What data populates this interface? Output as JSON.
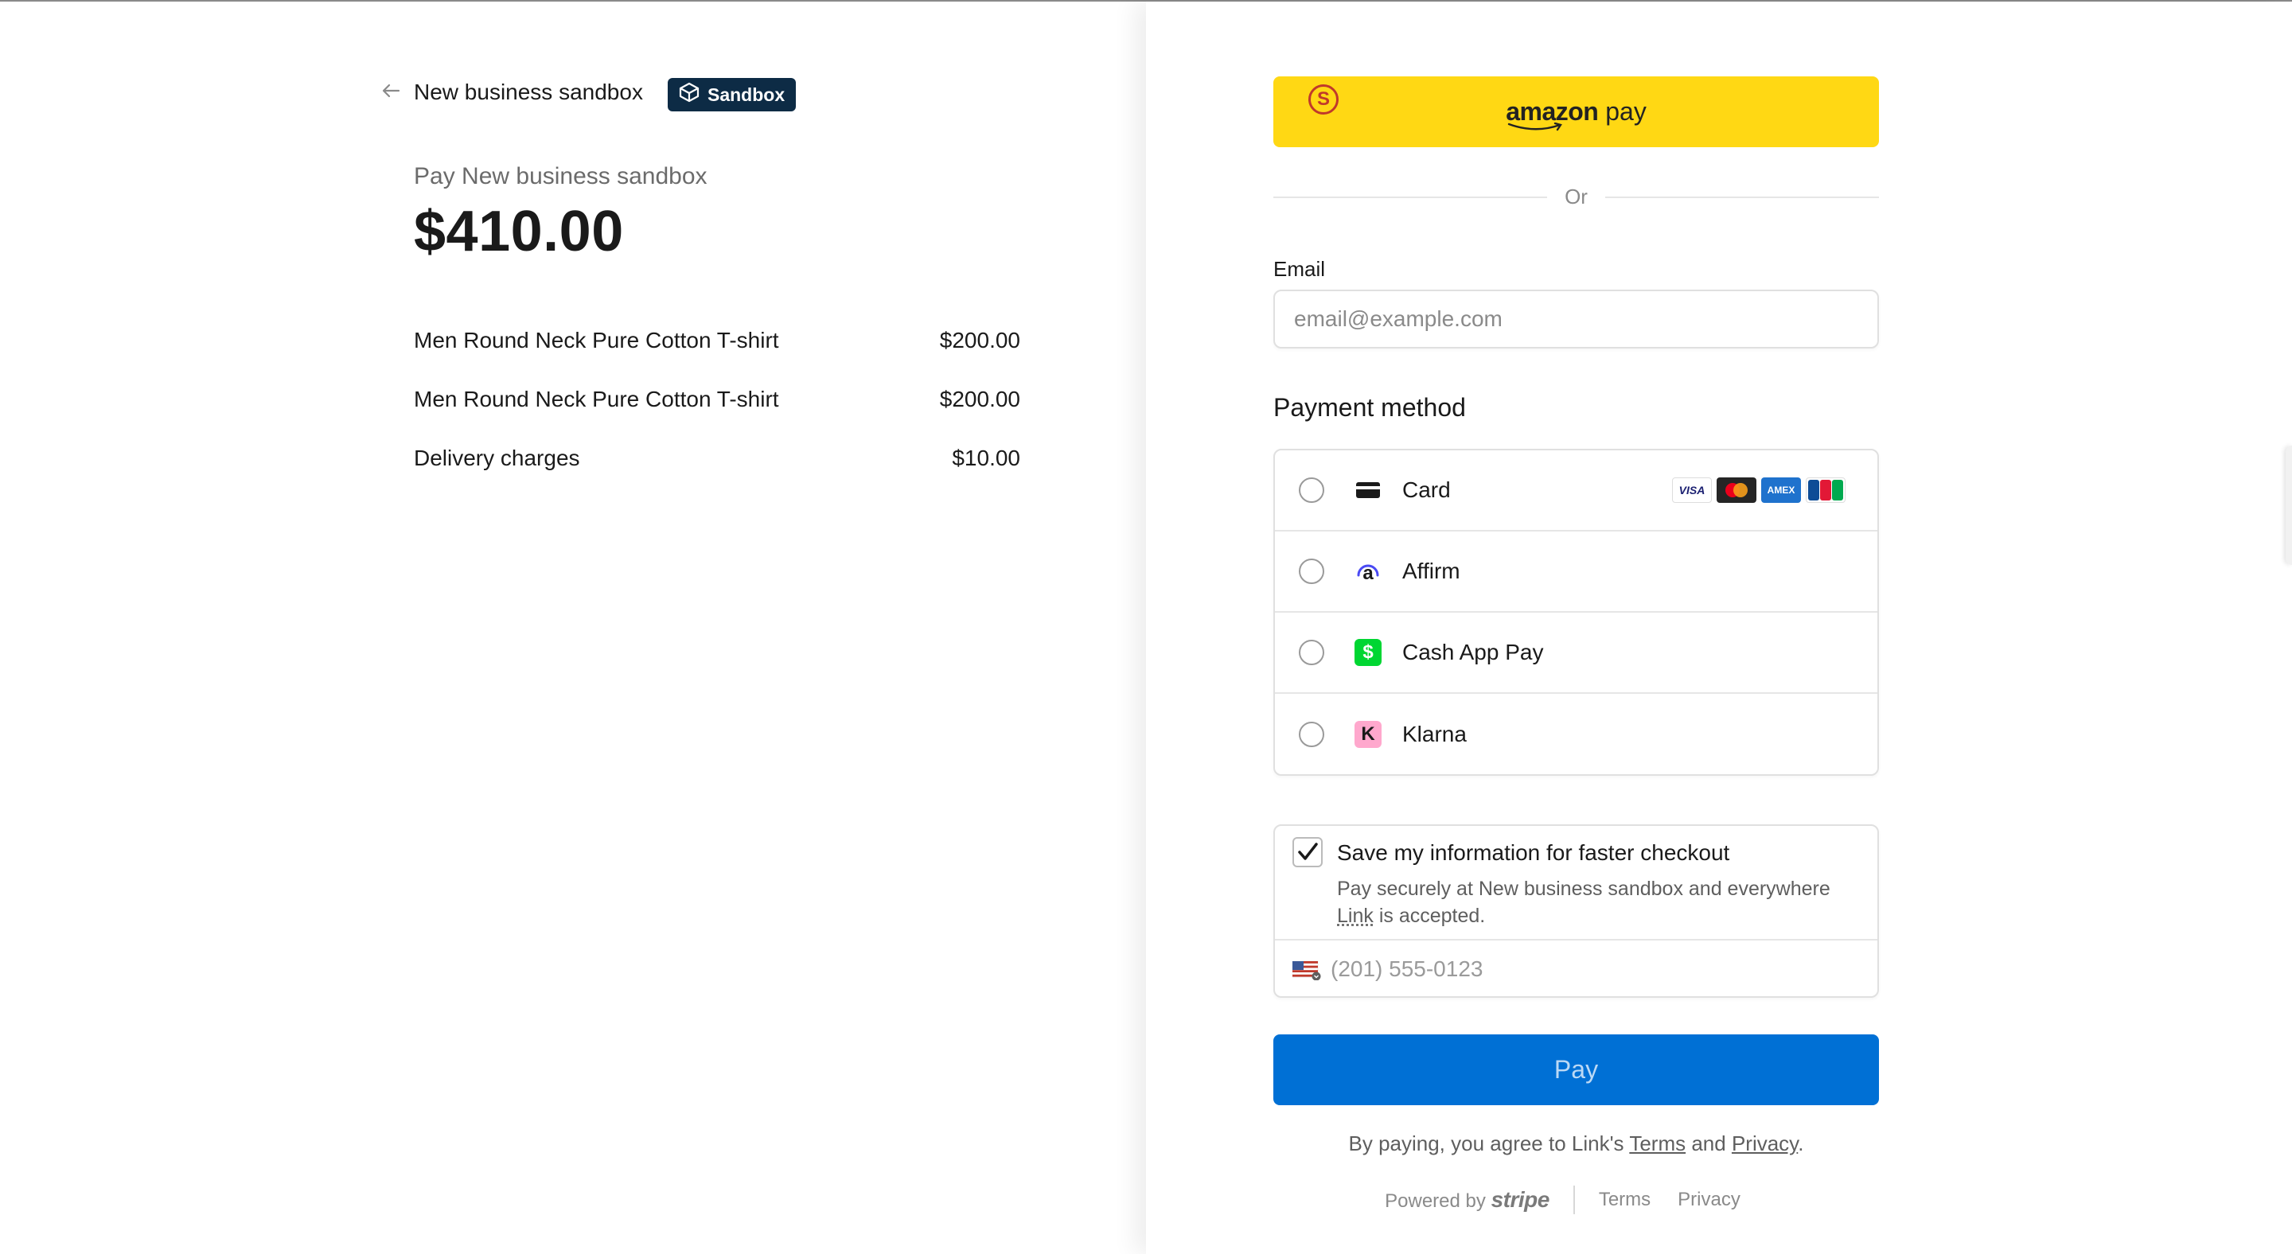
{
  "header": {
    "business_name": "New business sandbox",
    "badge": "Sandbox"
  },
  "summary": {
    "pay_label": "Pay New business sandbox",
    "total": "$410.00",
    "items": [
      {
        "name": "Men Round Neck Pure Cotton T-shirt",
        "price": "$200.00"
      },
      {
        "name": "Men Round Neck Pure Cotton T-shirt",
        "price": "$200.00"
      },
      {
        "name": "Delivery charges",
        "price": "$10.00"
      }
    ]
  },
  "express": {
    "amazon_word": "amazon",
    "pay_word": "pay",
    "badge_letter": "S",
    "or_text": "Or"
  },
  "email": {
    "label": "Email",
    "placeholder": "email@example.com"
  },
  "payment": {
    "title": "Payment method",
    "methods": [
      {
        "label": "Card",
        "icon": "card-icon"
      },
      {
        "label": "Affirm",
        "icon": "affirm-icon"
      },
      {
        "label": "Cash App Pay",
        "icon": "cash-app-icon"
      },
      {
        "label": "Klarna",
        "icon": "klarna-icon"
      }
    ],
    "brands": [
      "VISA",
      "MC",
      "AMEX",
      "JCB"
    ],
    "affirm_glyph": "a",
    "cashapp_glyph": "$",
    "klarna_glyph": "K"
  },
  "link": {
    "save_title": "Save my information for faster checkout",
    "sub_before": "Pay securely at New business sandbox and everywhere ",
    "sub_link": "Link",
    "sub_after": " is accepted.",
    "phone_placeholder": "(201) 555-0123",
    "checked": true
  },
  "pay_button": "Pay",
  "agreement": {
    "before": "By paying, you agree to Link's ",
    "terms": "Terms",
    "and": " and ",
    "privacy": "Privacy",
    "end": "."
  },
  "footer": {
    "powered_by": "Powered by",
    "brand": "stripe",
    "terms": "Terms",
    "privacy": "Privacy"
  },
  "colors": {
    "amazon_yellow": "#ffd814",
    "pay_blue": "#0070d5",
    "badge_navy": "#0d2b45",
    "cashapp_green": "#00d632",
    "klarna_pink": "#ffa8cd"
  }
}
